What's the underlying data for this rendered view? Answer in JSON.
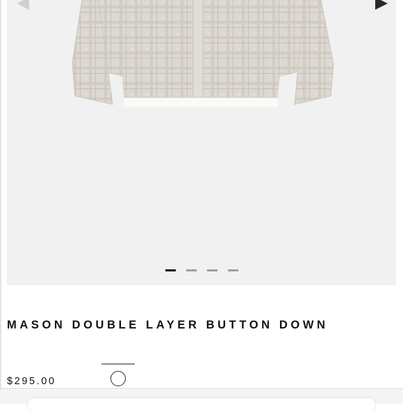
{
  "product": {
    "title": "MASON DOUBLE LAYER BUTTON DOWN",
    "price": "$295.00"
  },
  "gallery": {
    "image_count": 4,
    "active_index": 0,
    "prev_icon": "chevron-left-icon",
    "next_icon": "chevron-right-icon"
  },
  "variants": {
    "selected_swatch_color": "#ffffff"
  },
  "colors": {
    "gallery_background": "#f1f1f1",
    "shirt_main": "#d9d4ce",
    "shirt_inner_layer": "#fbfaf7",
    "indicator_active": "#111111",
    "indicator_inactive": "#9d9d9d"
  }
}
